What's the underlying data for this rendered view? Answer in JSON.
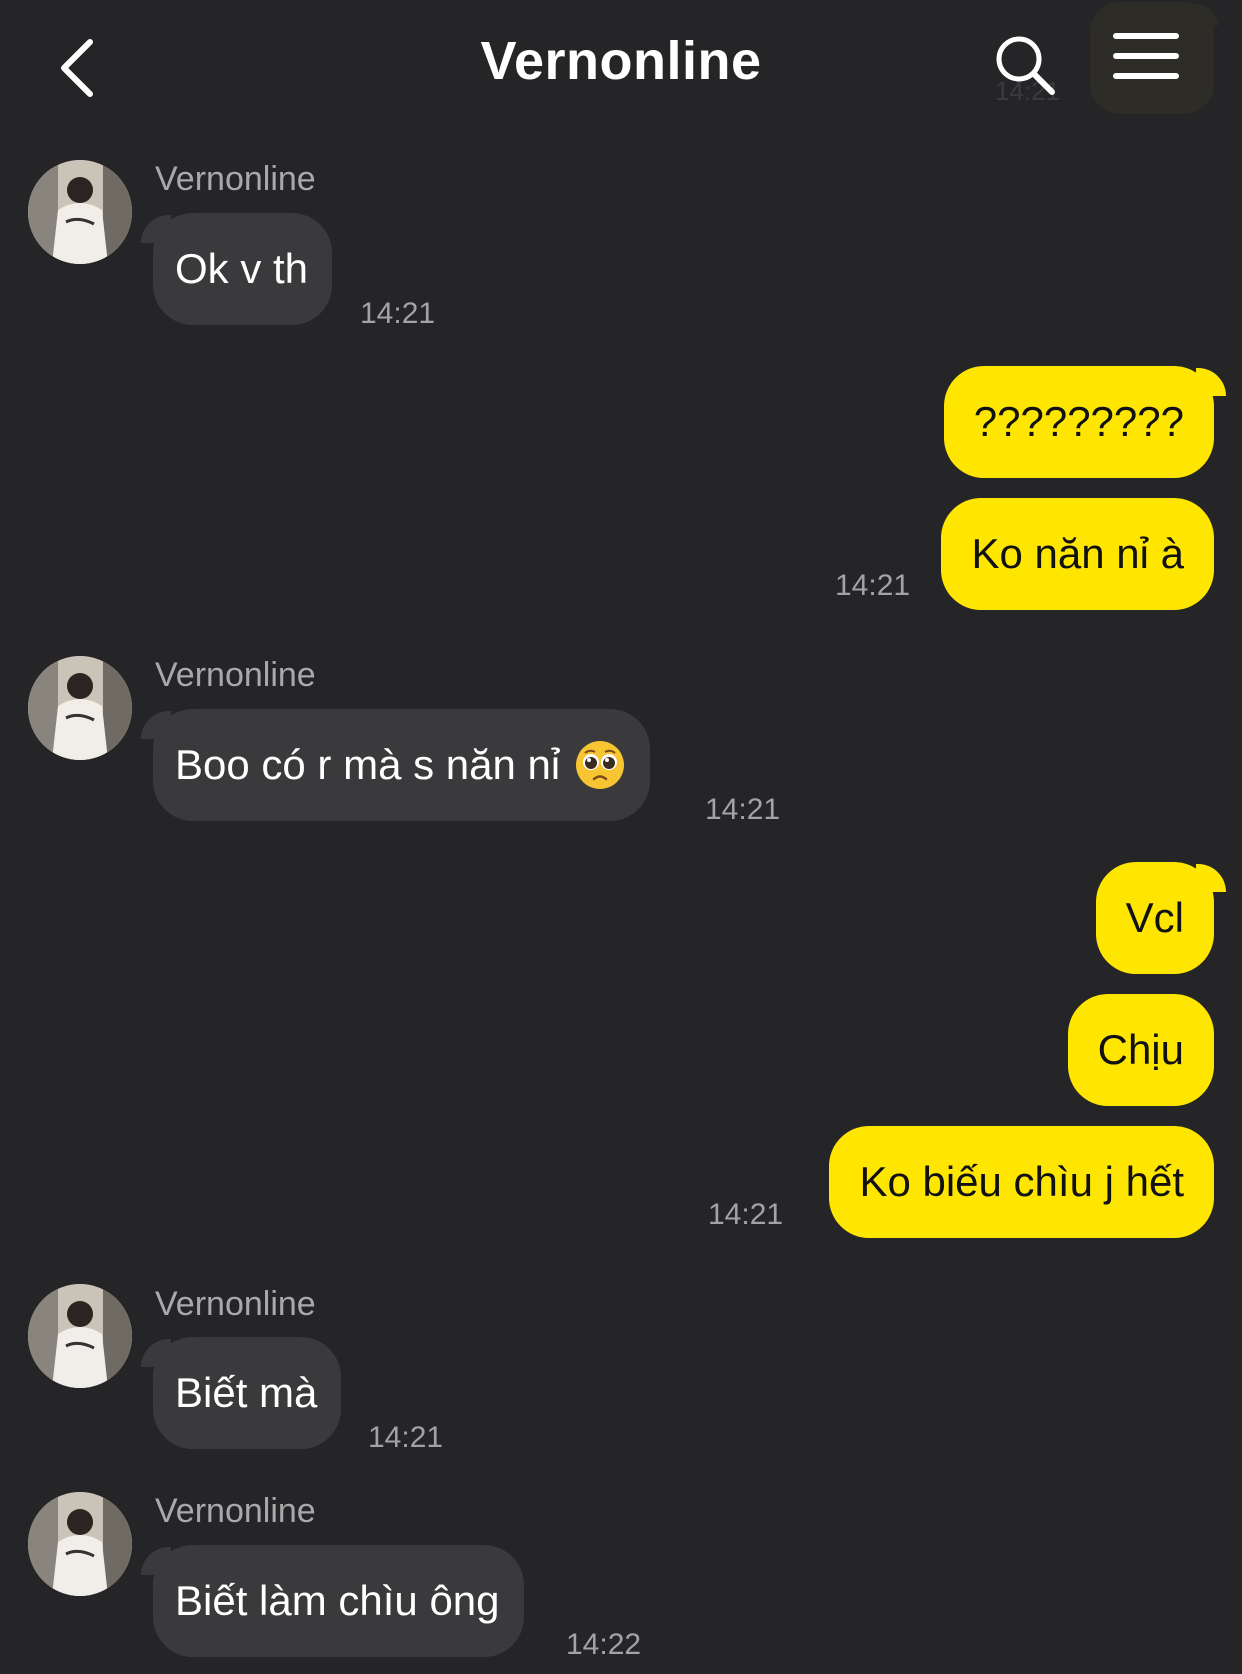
{
  "header": {
    "title": "Vernonline",
    "ghost_time": "14:21"
  },
  "messages": [
    {
      "direction": "in",
      "sender": "Vernonline",
      "text": "Ok v th",
      "time": "14:21"
    },
    {
      "direction": "out",
      "text": "?????????"
    },
    {
      "direction": "out",
      "text": "Ko năn nỉ à",
      "time": "14:21"
    },
    {
      "direction": "in",
      "sender": "Vernonline",
      "text": "Boo có r mà s năn nỉ",
      "emoji": "pleading-face-emoji",
      "time": "14:21"
    },
    {
      "direction": "out",
      "text": "Vcl"
    },
    {
      "direction": "out",
      "text": "Chịu"
    },
    {
      "direction": "out",
      "text": "Ko biếu chìu j hết",
      "time": "14:21"
    },
    {
      "direction": "in",
      "sender": "Vernonline",
      "text": "Biết mà",
      "time": "14:21"
    },
    {
      "direction": "in",
      "sender": "Vernonline",
      "text": "Biết làm chìu ông",
      "time": "14:22"
    }
  ],
  "colors": {
    "background": "#252527",
    "incoming_bubble": "#3a3a3c",
    "outgoing_bubble": "#ffe600",
    "timestamp": "#a3a3a5",
    "sender_name": "#a9a9ab"
  },
  "icons": {
    "back": "chevron-left-icon",
    "search": "search-icon",
    "menu": "hamburger-menu-icon"
  }
}
